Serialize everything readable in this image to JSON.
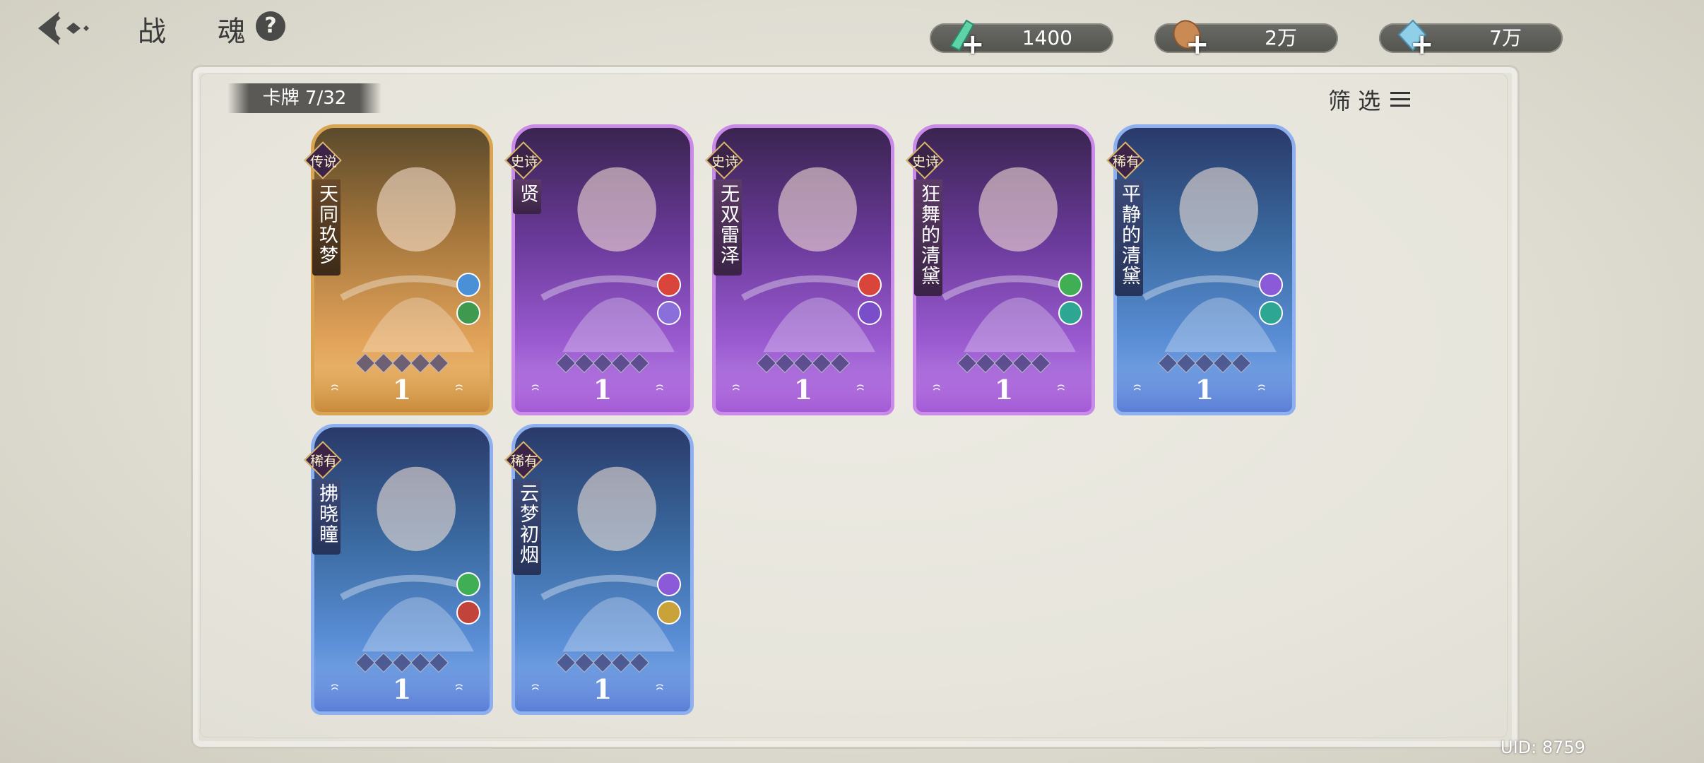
{
  "header": {
    "title": "战 魂",
    "help": "?"
  },
  "currencies": [
    {
      "name": "crystal",
      "value": "1400",
      "color": "#5fd3a8"
    },
    {
      "name": "coin",
      "value": "2万",
      "color": "#c98a54"
    },
    {
      "name": "diamond",
      "value": "7万",
      "color": "#8fd0e8"
    }
  ],
  "panel": {
    "card_count": "卡牌 7/32",
    "filter_label": "筛 选"
  },
  "uid": "UID: 8759",
  "cards": [
    {
      "rarity": "传说",
      "name": "天同玖梦",
      "level": "1",
      "theme": "legend",
      "icons": [
        "#4a90d6",
        "#3f9a4f"
      ]
    },
    {
      "rarity": "史诗",
      "name": "贤",
      "level": "1",
      "theme": "epic",
      "icons": [
        "#d9453a",
        "#8a6ed9"
      ]
    },
    {
      "rarity": "史诗",
      "name": "无双雷泽",
      "level": "1",
      "theme": "epic",
      "icons": [
        "#d9453a",
        "#7a4ec9"
      ]
    },
    {
      "rarity": "史诗",
      "name": "狂舞的清黛",
      "level": "1",
      "theme": "epic",
      "icons": [
        "#3fae55",
        "#2ea694"
      ]
    },
    {
      "rarity": "稀有",
      "name": "平静的清黛",
      "level": "1",
      "theme": "rare",
      "icons": [
        "#8a5ad9",
        "#2ea694"
      ]
    },
    {
      "rarity": "稀有",
      "name": "拂晓瞳",
      "level": "1",
      "theme": "rare",
      "icons": [
        "#3fae55",
        "#c2433a"
      ]
    },
    {
      "rarity": "稀有",
      "name": "云梦初烟",
      "level": "1",
      "theme": "rare",
      "icons": [
        "#8a5ad9",
        "#c9a23a"
      ]
    }
  ]
}
